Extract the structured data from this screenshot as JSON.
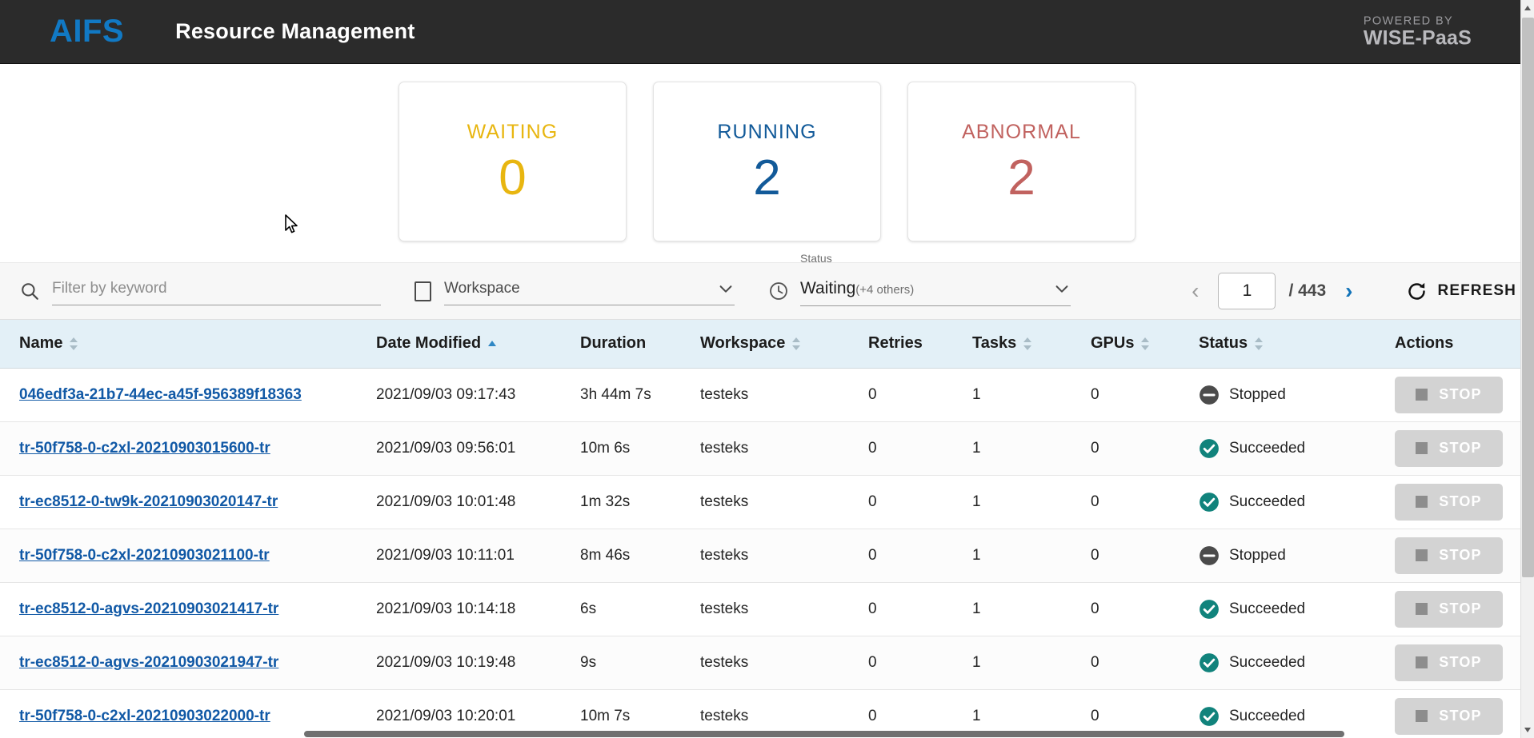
{
  "header": {
    "logo": "AIFS",
    "title": "Resource Management",
    "powered_by_small": "POWERED BY",
    "powered_by_brand": "WISE-PaaS",
    "bg_color": "#2b2b2b",
    "logo_color": "#1179c4"
  },
  "summary_cards": [
    {
      "label": "WAITING",
      "value": "0",
      "color": "#e8b610"
    },
    {
      "label": "RUNNING",
      "value": "2",
      "color": "#125a99"
    },
    {
      "label": "ABNORMAL",
      "value": "2",
      "color": "#c1625f"
    }
  ],
  "toolbar": {
    "search_placeholder": "Filter by keyword",
    "search_value": "",
    "search_icon": "search-icon",
    "workspace_label": "Workspace",
    "workspace_icon": "checkbox-square-icon",
    "status_caption": "Status",
    "status_value": "Waiting",
    "status_others": "(+4 others)",
    "status_icon": "clock-icon",
    "prev_page_icon": "chevron-left-icon",
    "next_page_icon": "chevron-right-icon",
    "page_current": "1",
    "page_total": "/ 443",
    "refresh_label": "REFRESH",
    "refresh_icon": "refresh-icon"
  },
  "table": {
    "columns": [
      {
        "key": "name",
        "label": "Name",
        "sort": "neutral"
      },
      {
        "key": "date",
        "label": "Date Modified",
        "sort": "asc"
      },
      {
        "key": "duration",
        "label": "Duration",
        "sort": "none"
      },
      {
        "key": "workspace",
        "label": "Workspace",
        "sort": "neutral"
      },
      {
        "key": "retries",
        "label": "Retries",
        "sort": "none"
      },
      {
        "key": "tasks",
        "label": "Tasks",
        "sort": "neutral"
      },
      {
        "key": "gpus",
        "label": "GPUs",
        "sort": "neutral"
      },
      {
        "key": "status",
        "label": "Status",
        "sort": "neutral"
      },
      {
        "key": "actions",
        "label": "Actions",
        "sort": "none"
      }
    ],
    "rows": [
      {
        "name": "046edf3a-21b7-44ec-a45f-956389f18363",
        "date": "2021/09/03 09:17:43",
        "duration": "3h 44m 7s",
        "workspace": "testeks",
        "retries": "0",
        "tasks": "1",
        "gpus": "0",
        "status": "Stopped",
        "status_icon": "minus-circle-icon",
        "status_color": "#4b4b4b",
        "action_label": "STOP"
      },
      {
        "name": "tr-50f758-0-c2xl-20210903015600-tr",
        "date": "2021/09/03 09:56:01",
        "duration": "10m 6s",
        "workspace": "testeks",
        "retries": "0",
        "tasks": "1",
        "gpus": "0",
        "status": "Succeeded",
        "status_icon": "check-circle-icon",
        "status_color": "#11837c",
        "action_label": "STOP"
      },
      {
        "name": "tr-ec8512-0-tw9k-20210903020147-tr",
        "date": "2021/09/03 10:01:48",
        "duration": "1m 32s",
        "workspace": "testeks",
        "retries": "0",
        "tasks": "1",
        "gpus": "0",
        "status": "Succeeded",
        "status_icon": "check-circle-icon",
        "status_color": "#11837c",
        "action_label": "STOP"
      },
      {
        "name": "tr-50f758-0-c2xl-20210903021100-tr",
        "date": "2021/09/03 10:11:01",
        "duration": "8m 46s",
        "workspace": "testeks",
        "retries": "0",
        "tasks": "1",
        "gpus": "0",
        "status": "Stopped",
        "status_icon": "minus-circle-icon",
        "status_color": "#4b4b4b",
        "action_label": "STOP"
      },
      {
        "name": "tr-ec8512-0-agvs-20210903021417-tr",
        "date": "2021/09/03 10:14:18",
        "duration": "6s",
        "workspace": "testeks",
        "retries": "0",
        "tasks": "1",
        "gpus": "0",
        "status": "Succeeded",
        "status_icon": "check-circle-icon",
        "status_color": "#11837c",
        "action_label": "STOP"
      },
      {
        "name": "tr-ec8512-0-agvs-20210903021947-tr",
        "date": "2021/09/03 10:19:48",
        "duration": "9s",
        "workspace": "testeks",
        "retries": "0",
        "tasks": "1",
        "gpus": "0",
        "status": "Succeeded",
        "status_icon": "check-circle-icon",
        "status_color": "#11837c",
        "action_label": "STOP"
      },
      {
        "name": "tr-50f758-0-c2xl-20210903022000-tr",
        "date": "2021/09/03 10:20:01",
        "duration": "10m 7s",
        "workspace": "testeks",
        "retries": "0",
        "tasks": "1",
        "gpus": "0",
        "status": "Succeeded",
        "status_icon": "check-circle-icon",
        "status_color": "#11837c",
        "action_label": "STOP"
      }
    ]
  }
}
